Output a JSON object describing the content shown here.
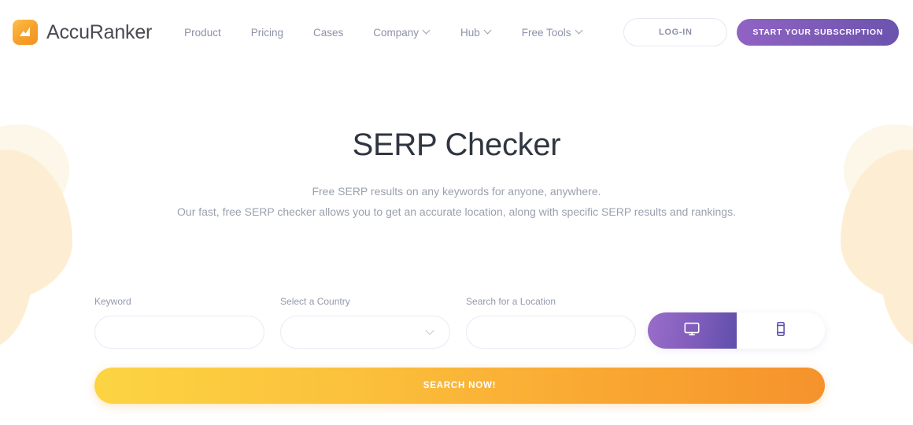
{
  "brand": {
    "name": "AccuRanker",
    "logo_icon": "chart-mountain-logo-icon",
    "logo_color": "#f6a02c"
  },
  "header": {
    "nav": [
      {
        "label": "Product",
        "has_dropdown": false
      },
      {
        "label": "Pricing",
        "has_dropdown": false
      },
      {
        "label": "Cases",
        "has_dropdown": false
      },
      {
        "label": "Company",
        "has_dropdown": true
      },
      {
        "label": "Hub",
        "has_dropdown": true
      },
      {
        "label": "Free Tools",
        "has_dropdown": true
      }
    ],
    "login_label": "LOG-IN",
    "subscribe_label": "START YOUR SUBSCRIPTION",
    "subscribe_color": "#7e5bb8"
  },
  "hero": {
    "title": "SERP Checker",
    "subtitle_line1": "Free SERP results on any keywords for anyone, anywhere.",
    "subtitle_line2": "Our fast, free SERP checker allows you to get an accurate location, along with specific SERP results and rankings."
  },
  "form": {
    "keyword": {
      "label": "Keyword",
      "value": "",
      "placeholder": ""
    },
    "country": {
      "label": "Select a Country",
      "value": "",
      "placeholder": "",
      "chevron_icon": "chevron-down-icon"
    },
    "location": {
      "label": "Search for a Location",
      "value": "",
      "placeholder": ""
    },
    "device_toggle": {
      "desktop": {
        "icon": "desktop-monitor-icon",
        "active": true
      },
      "mobile": {
        "icon": "mobile-phone-icon",
        "active": false
      },
      "active_color": "#7f5cbb"
    },
    "search_button": {
      "label": "SEARCH NOW!",
      "gradient_start": "#fcd442",
      "gradient_end": "#f5922c"
    }
  }
}
